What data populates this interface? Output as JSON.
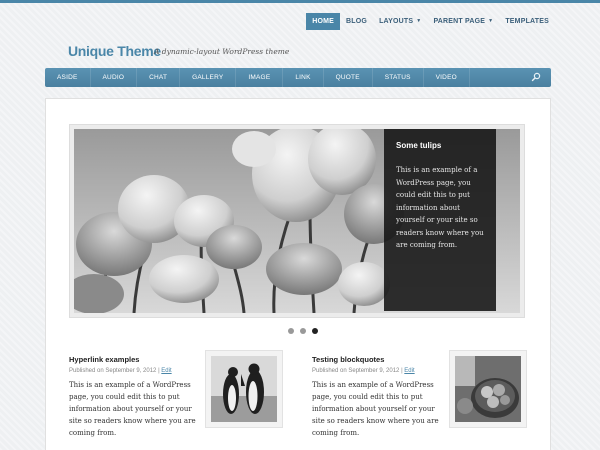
{
  "topnav": {
    "items": [
      {
        "label": "HOME",
        "active": true
      },
      {
        "label": "BLOG"
      },
      {
        "label": "LAYOUTS",
        "dropdown": true
      },
      {
        "label": "PARENT PAGE",
        "dropdown": true
      },
      {
        "label": "TEMPLATES"
      }
    ]
  },
  "header": {
    "title": "Unique Theme",
    "tagline": "A dynamic-layout WordPress theme"
  },
  "categories": [
    "ASIDE",
    "AUDIO",
    "CHAT",
    "GALLERY",
    "IMAGE",
    "LINK",
    "QUOTE",
    "STATUS",
    "VIDEO"
  ],
  "slider": {
    "caption_title": "Some tulips",
    "caption_text": "This is an example of a WordPress page, you could edit this to put information about yourself or your site so readers know where you are coming from.",
    "image_icon": "tulips-photo",
    "dots": 3,
    "active_dot": 2
  },
  "posts": [
    {
      "title": "Hyperlink examples",
      "meta_prefix": "Published on September 9, 2012 |",
      "edit_label": "Edit",
      "excerpt": "This is an example of a WordPress page, you could edit this to put information about yourself or your site so readers know where you are coming from.",
      "thumb_icon": "penguins-photo"
    },
    {
      "title": "Testing blockquotes",
      "meta_prefix": "Published on September 9, 2012 |",
      "edit_label": "Edit",
      "excerpt": "This is an example of a WordPress page, you could edit this to put information about yourself or your site so readers know where you are coming from.",
      "thumb_icon": "fruit-bowl-photo"
    }
  ],
  "colors": {
    "accent": "#4a86a8",
    "caption_bg": "#141414",
    "background": "#eef0f2"
  }
}
